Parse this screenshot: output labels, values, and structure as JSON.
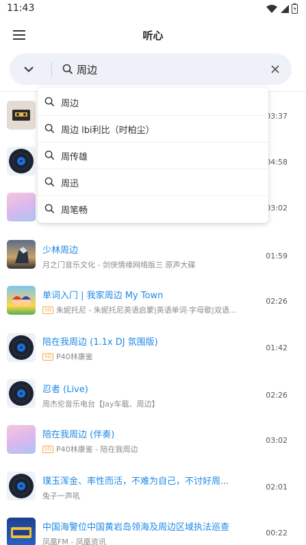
{
  "status": {
    "time": "11:43"
  },
  "app": {
    "title": "听心"
  },
  "search": {
    "value": "周边"
  },
  "suggestions": [
    {
      "text": "周边"
    },
    {
      "text": "周边 lbi利比（时柏尘）"
    },
    {
      "text": "周传雄"
    },
    {
      "text": "周迅"
    },
    {
      "text": "周笔畅"
    }
  ],
  "tracks": [
    {
      "title": "",
      "subtitle": "",
      "sq": false,
      "duration": "03:37",
      "thumb": "cassette"
    },
    {
      "title": "",
      "subtitle": "",
      "sq": false,
      "duration": "04:58",
      "thumb": "vinyl"
    },
    {
      "title": "",
      "subtitle": "",
      "sq": false,
      "duration": "03:02",
      "thumb": "pink"
    },
    {
      "title": "少林周边",
      "subtitle": "月之门音乐文化 - 剑侠情缘网络版三 原声大碟",
      "sq": false,
      "duration": "01:59",
      "thumb": "armor"
    },
    {
      "title": "单词入门 | 我家周边 My Town",
      "subtitle": "朱妮托尼 - 朱妮托尼英语启蒙|英语单词·字母歌|双语...",
      "sq": true,
      "duration": "02:26",
      "thumb": "kids"
    },
    {
      "title": "陪在我周边 (1.1x DJ 氛围版)",
      "subtitle": "P40林康鉴",
      "sq": true,
      "duration": "01:42",
      "thumb": "vinyl"
    },
    {
      "title": "忍者 (Live)",
      "subtitle": "周杰伦音乐电台【Jay车载、周边】",
      "sq": false,
      "duration": "02:26",
      "thumb": "vinyl"
    },
    {
      "title": "陪在我周边 (伴奏)",
      "subtitle": "P40林康鉴 - 陪在我周边",
      "sq": true,
      "duration": "03:02",
      "thumb": "pink"
    },
    {
      "title": " 璞玉浑金、率性而活，不难为自己，不讨好周...",
      "subtitle": "兔子一声吼",
      "sq": false,
      "duration": "02:01",
      "thumb": "vinyl"
    },
    {
      "title": "中国海警位中国黄岩岛领海及周边区域执法巡查",
      "subtitle": "凤凰FM - 凤凰资讯",
      "sq": false,
      "duration": "00:22",
      "thumb": "news"
    }
  ],
  "sq_label": "SQ",
  "colors": {
    "accent": "#1e88e5",
    "search_bg": "#eef2f8",
    "sq": "#f0a94a"
  }
}
